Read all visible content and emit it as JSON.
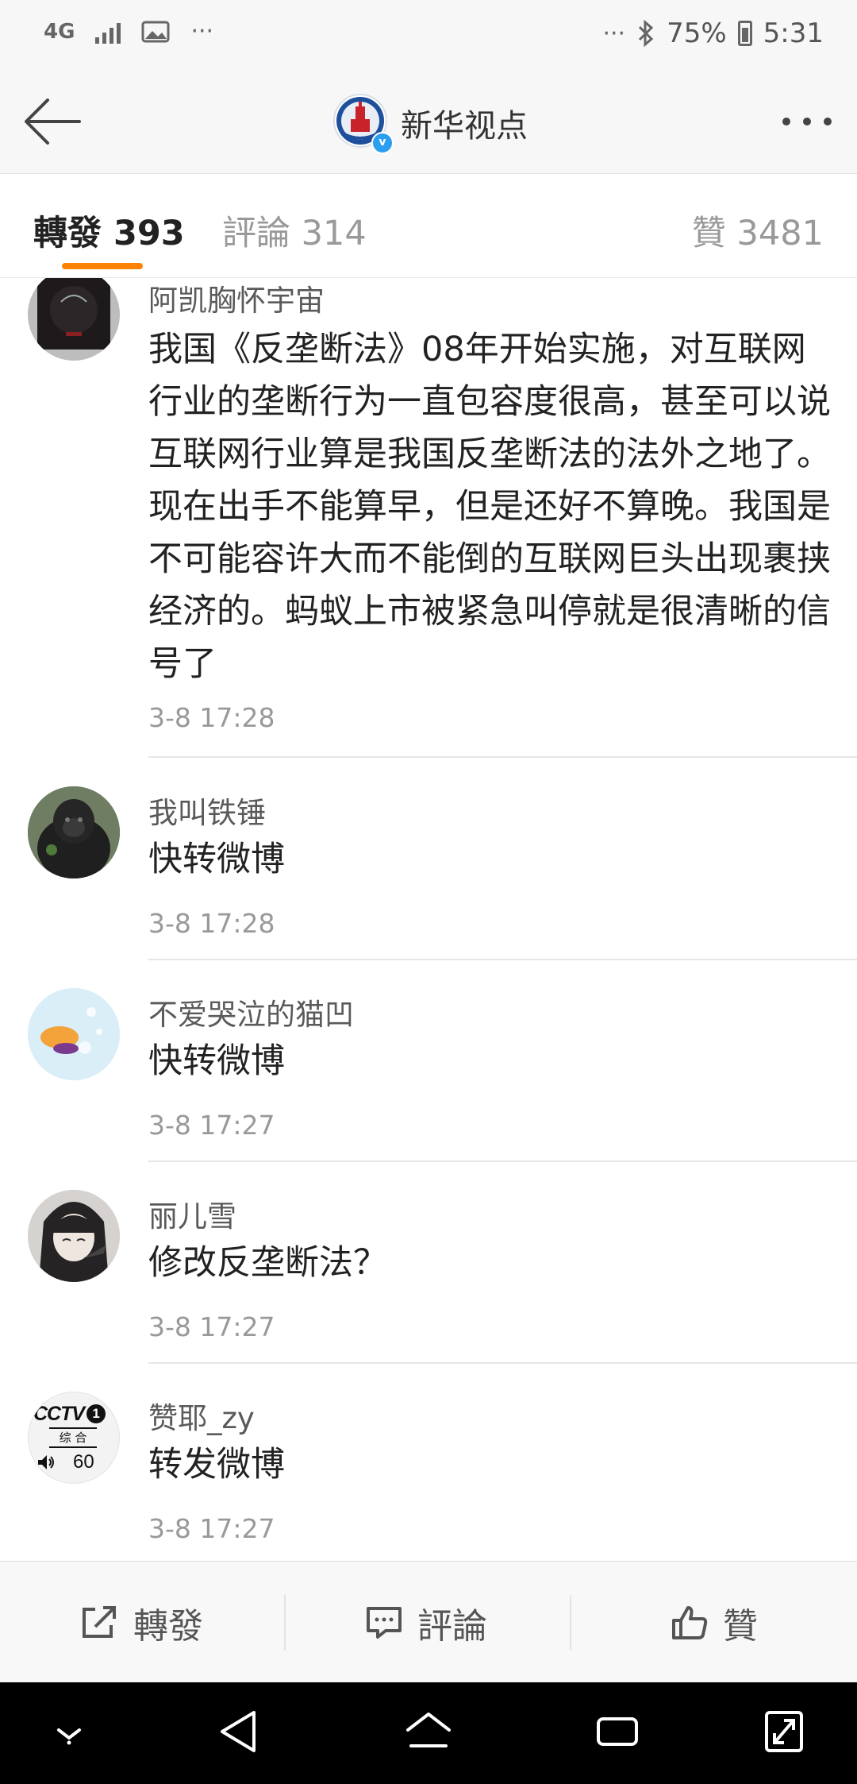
{
  "status_bar": {
    "network": "4G",
    "battery": "75%",
    "time": "5:31",
    "dots_left": "···",
    "dots_right": "···"
  },
  "header": {
    "account_name": "新华视点",
    "back_icon": "back-arrow-icon",
    "more_icon": "more-dots-icon"
  },
  "tabs": {
    "repost_label": "轉發 393",
    "comment_label": "評論 314",
    "like_label": "贊 3481",
    "active": "repost",
    "accent": "#ff8200"
  },
  "reposts": [
    {
      "user": "阿凯胸怀宇宙",
      "text": "我国《反垄断法》08年开始实施，对互联网行业的垄断行为一直包容度很高，甚至可以说互联网行业算是我国反垄断法的法外之地了。现在出手不能算早，但是还好不算晚。我国是不可能容许大而不能倒的互联网巨头出现裹挟经济的。蚂蚁上市被紧急叫停就是很清晰的信号了",
      "time": "3-8 17:28"
    },
    {
      "user": "我叫铁锤",
      "text": "快转微博",
      "time": "3-8 17:28"
    },
    {
      "user": "不爱哭泣的猫凹",
      "text": "快转微博",
      "time": "3-8 17:27"
    },
    {
      "user": "丽儿雪",
      "text": "修改反垄断法？",
      "time": "3-8 17:27"
    },
    {
      "user": "赞耶_zy",
      "text": "转发微博",
      "time": "3-8 17:27"
    }
  ],
  "avatar_badge": {
    "line1": "CCTV",
    "channel": "1",
    "line2": "综 合",
    "volume": "60"
  },
  "toolbar": {
    "repost_label": "轉發",
    "comment_label": "評論",
    "like_label": "贊"
  }
}
